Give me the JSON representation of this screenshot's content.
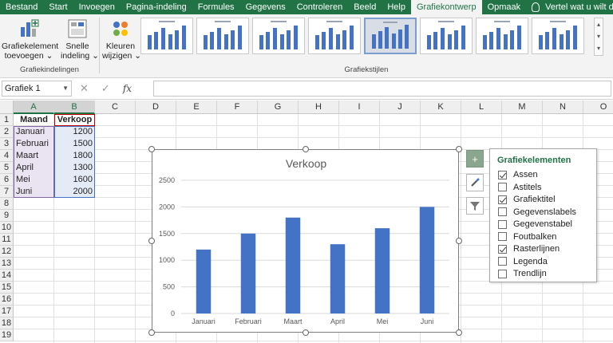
{
  "ribbon_tabs": [
    "Bestand",
    "Start",
    "Invoegen",
    "Pagina-indeling",
    "Formules",
    "Gegevens",
    "Controleren",
    "Beeld",
    "Help",
    "Grafiekontwerp",
    "Opmaak"
  ],
  "active_tab": "Grafiekontwerp",
  "tell_me": "Vertel wat u wilt doen",
  "ribbon": {
    "add_element_line1": "Grafiekelement",
    "add_element_line2": "toevoegen",
    "quick_layout_line1": "Snelle",
    "quick_layout_line2": "indeling",
    "colors_line1": "Kleuren",
    "colors_line2": "wijzigen",
    "group_layouts": "Grafiekindelingen",
    "group_styles": "Grafiekstijlen",
    "style_thumb_count": 8,
    "selected_style_index": 4
  },
  "formula_bar": {
    "name_box": "Grafiek 1",
    "formula": ""
  },
  "sheet": {
    "columns": [
      "A",
      "B",
      "C",
      "D",
      "E",
      "F",
      "G",
      "H",
      "I",
      "J",
      "K",
      "L",
      "M",
      "N",
      "O"
    ],
    "rows": [
      "1",
      "2",
      "3",
      "4",
      "5",
      "6",
      "7",
      "8",
      "9",
      "10",
      "11",
      "12",
      "13",
      "14",
      "15",
      "16",
      "17",
      "18",
      "19"
    ],
    "header_a": "Maand",
    "header_b": "Verkoop",
    "data": [
      {
        "month": "Januari",
        "sales": "1200"
      },
      {
        "month": "Februari",
        "sales": "1500"
      },
      {
        "month": "Maart",
        "sales": "1800"
      },
      {
        "month": "April",
        "sales": "1300"
      },
      {
        "month": "Mei",
        "sales": "1600"
      },
      {
        "month": "Juni",
        "sales": "2000"
      }
    ]
  },
  "chart_data": {
    "type": "bar",
    "title": "Verkoop",
    "categories": [
      "Januari",
      "Februari",
      "Maart",
      "April",
      "Mei",
      "Juni"
    ],
    "values": [
      1200,
      1500,
      1800,
      1300,
      1600,
      2000
    ],
    "ylim": [
      0,
      2500
    ],
    "yticks": [
      0,
      500,
      1000,
      1500,
      2000,
      2500
    ],
    "xlabel": "",
    "ylabel": "",
    "grid": true,
    "legend": "none",
    "bar_color": "#4472c4"
  },
  "elements_pane": {
    "title": "Grafiekelementen",
    "items": [
      {
        "label": "Assen",
        "checked": true
      },
      {
        "label": "Astitels",
        "checked": false
      },
      {
        "label": "Grafiektitel",
        "checked": true
      },
      {
        "label": "Gegevenslabels",
        "checked": false
      },
      {
        "label": "Gegevenstabel",
        "checked": false
      },
      {
        "label": "Foutbalken",
        "checked": false
      },
      {
        "label": "Rasterlijnen",
        "checked": true
      },
      {
        "label": "Legenda",
        "checked": false
      },
      {
        "label": "Trendlijn",
        "checked": false
      }
    ]
  },
  "colors": {
    "excel_green": "#217346",
    "bar": "#4472c4"
  }
}
